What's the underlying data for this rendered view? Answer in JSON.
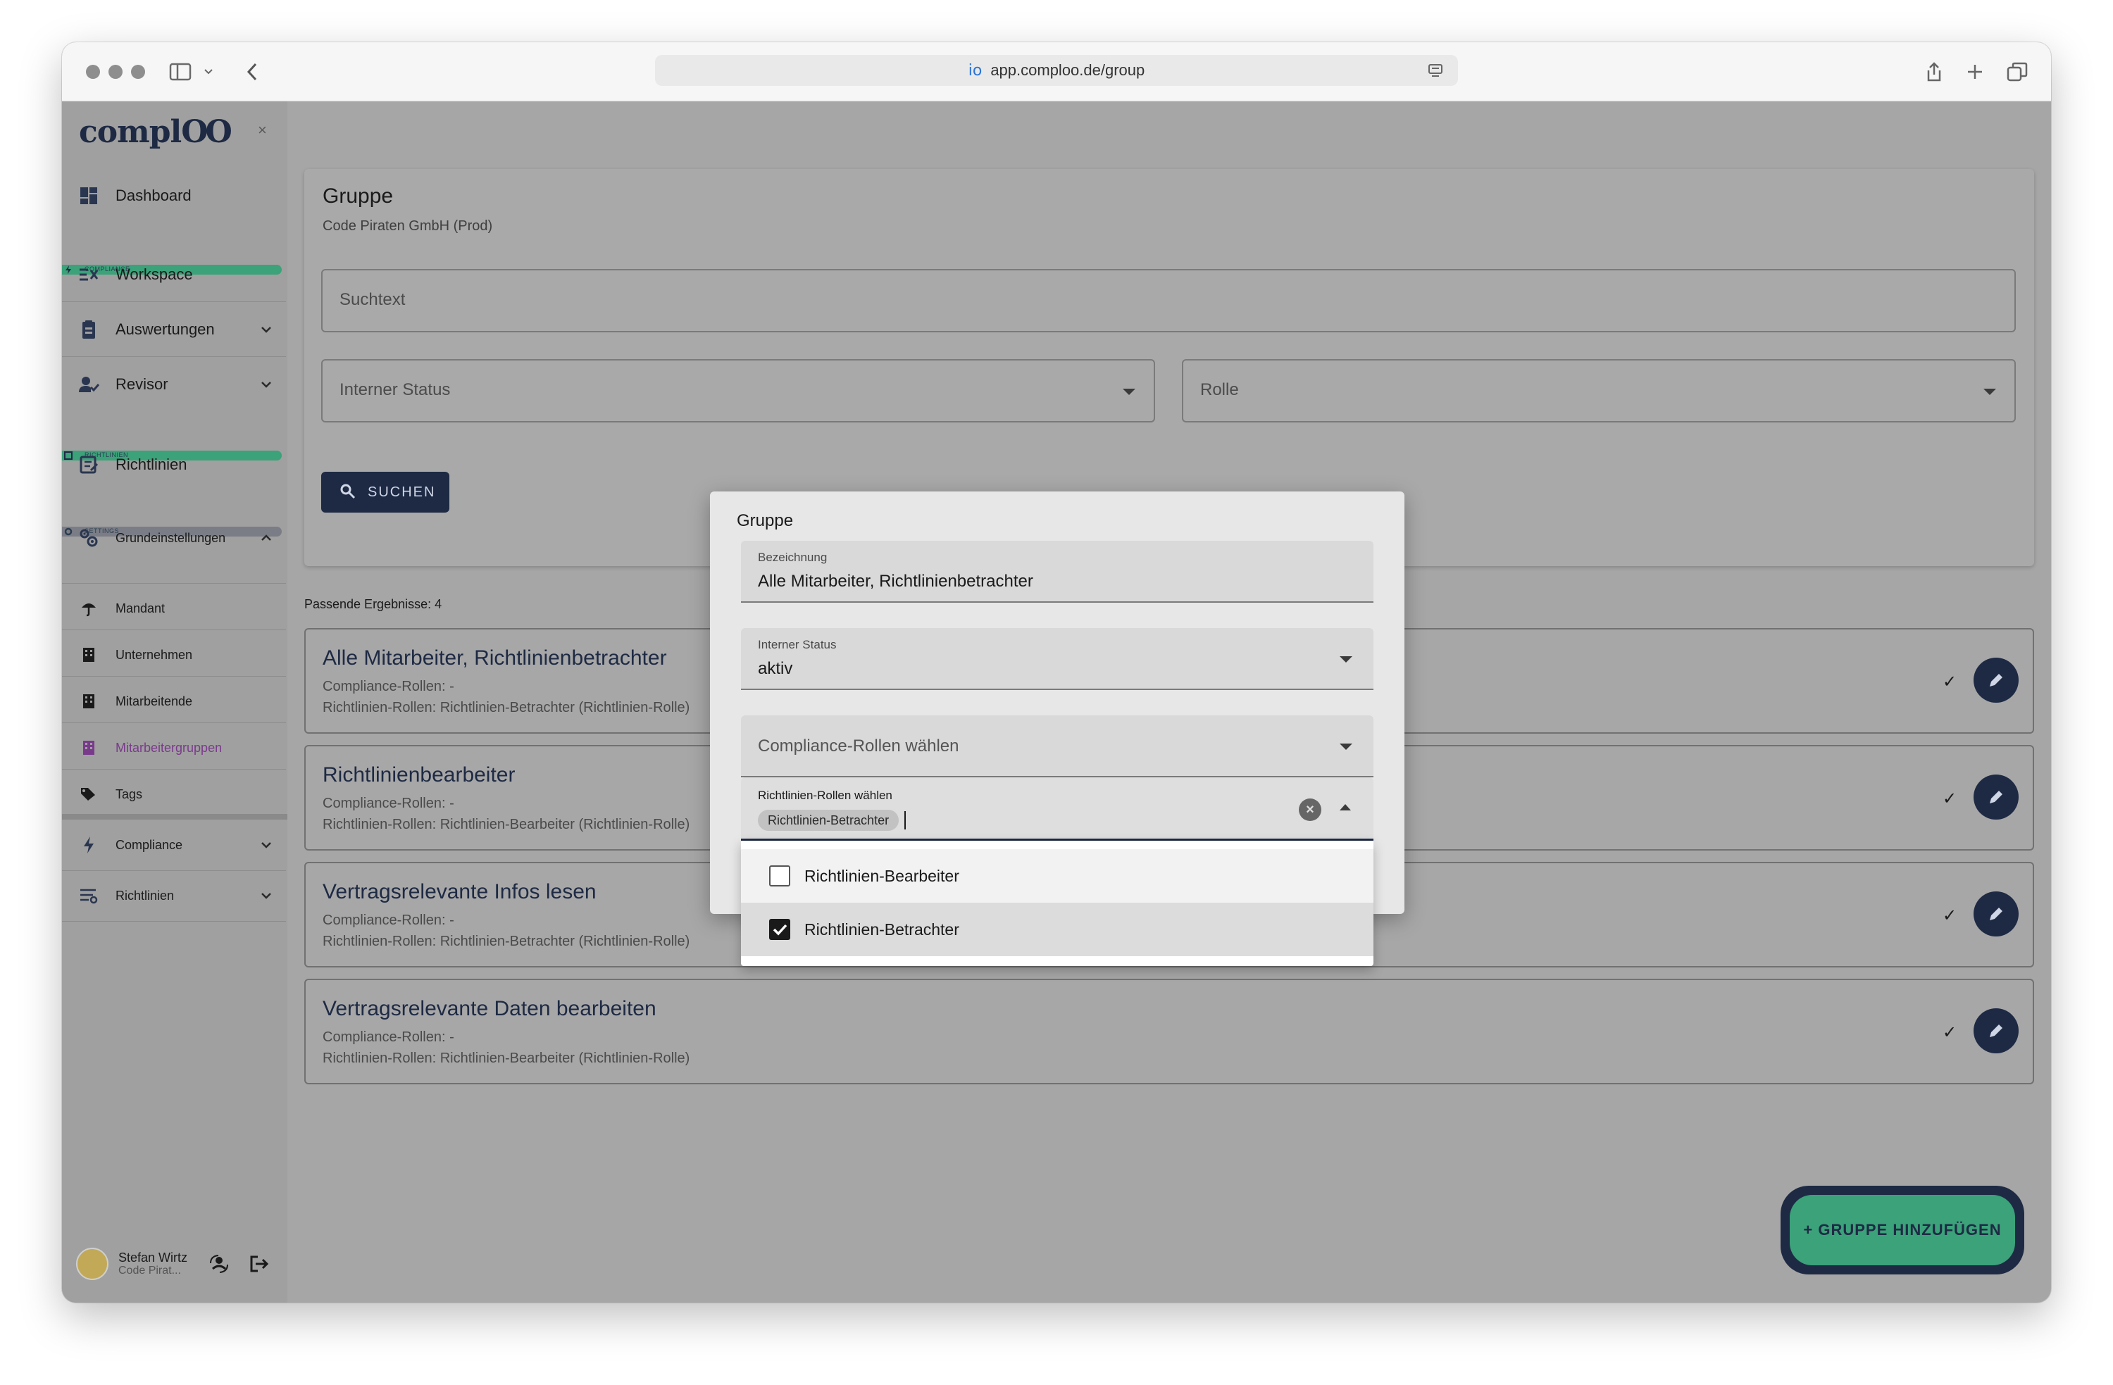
{
  "browser": {
    "url": "app.comploo.de/group"
  },
  "sidebar": {
    "logo": "complOO",
    "logo_main": "compl",
    "logo_end": "OO",
    "close": "×",
    "dashboard": "Dashboard",
    "section_compliance": "COMPLIANCE",
    "workspace": "Workspace",
    "auswertungen": "Auswertungen",
    "revisor": "Revisor",
    "section_richtlinien": "RICHTLINIEN",
    "richtlinien": "Richtlinien",
    "section_settings": "SETTINGS",
    "grundeinstellungen": "Grundeinstellungen",
    "sub_items": [
      "Mandant",
      "Unternehmen",
      "Mitarbeitende",
      "Mitarbeitergruppen",
      "Tags"
    ],
    "compliance": "Compliance",
    "richtlinien2": "Richtlinien",
    "user_name": "Stefan Wirtz",
    "user_company": "Code Pirat..."
  },
  "search": {
    "title": "Gruppe",
    "subtitle": "Code Piraten GmbH (Prod)",
    "suchtext_placeholder": "Suchtext",
    "status_placeholder": "Interner Status",
    "rolle_placeholder": "Rolle",
    "button_label": "SUCHEN"
  },
  "results": {
    "count_label": "Passende Ergebnisse: 4",
    "items": [
      {
        "title": "Alle Mitarbeiter, Richtlinienbetrachter",
        "compliance": "Compliance-Rollen: -",
        "richtlinien": "Richtlinien-Rollen: Richtlinien-Betrachter (Richtlinien-Rolle)"
      },
      {
        "title": "Richtlinienbearbeiter",
        "compliance": "Compliance-Rollen: -",
        "richtlinien": "Richtlinien-Rollen: Richtlinien-Bearbeiter (Richtlinien-Rolle)"
      },
      {
        "title": "Vertragsrelevante Infos lesen",
        "compliance": "Compliance-Rollen: -",
        "richtlinien": "Richtlinien-Rollen: Richtlinien-Betrachter (Richtlinien-Rolle)"
      },
      {
        "title": "Vertragsrelevante Daten bearbeiten",
        "compliance": "Compliance-Rollen: -",
        "richtlinien": "Richtlinien-Rollen: Richtlinien-Bearbeiter (Richtlinien-Rolle)"
      }
    ],
    "check": "✓"
  },
  "fab": {
    "label": "+ GRUPPE HINZUFÜGEN"
  },
  "modal": {
    "title": "Gruppe",
    "bezeichnung_label": "Bezeichnung",
    "bezeichnung_value": "Alle Mitarbeiter, Richtlinienbetrachter",
    "status_label": "Interner Status",
    "status_value": "aktiv",
    "compliance_placeholder": "Compliance-Rollen wählen",
    "richtlinien_label": "Richtlinien-Rollen wählen",
    "richtlinien_chip": "Richtlinien-Betrachter",
    "options": [
      {
        "label": "Richtlinien-Bearbeiter",
        "checked": false
      },
      {
        "label": "Richtlinien-Betrachter",
        "checked": true
      }
    ]
  },
  "colors": {
    "navy": "#1e2a44",
    "green": "#3ba27a",
    "active_sub": "#7a3a8c"
  }
}
